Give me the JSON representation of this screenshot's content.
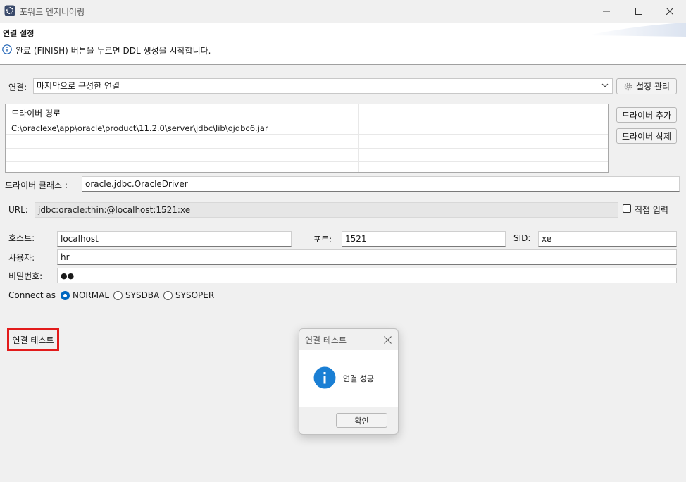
{
  "window": {
    "title": "포워드 엔지니어링",
    "minimize_icon": "minimize-icon",
    "maximize_icon": "maximize-icon",
    "close_icon": "close-icon"
  },
  "header": {
    "title": "연결 설정",
    "message": "완료 (FINISH) 버튼을 누르면 DDL 생성을 시작합니다.",
    "icon": "info-icon"
  },
  "connection": {
    "label": "연결:",
    "selected": "마지막으로 구성한 연결",
    "manage_button": "설정 관리"
  },
  "driver": {
    "path_header": "드라이버 경로",
    "paths": [
      "C:\\oraclexe\\app\\oracle\\product\\11.2.0\\server\\jdbc\\lib\\ojdbc6.jar"
    ],
    "add_button": "드라이버 추가",
    "remove_button": "드라이버 삭제",
    "class_label": "드라이버 클래스 :",
    "class_value": "oracle.jdbc.OracleDriver"
  },
  "url": {
    "label": "URL:",
    "value": "jdbc:oracle:thin:@localhost:1521:xe",
    "direct_input_label": "직접 입력",
    "direct_input_checked": false
  },
  "fields": {
    "host_label": "호스트:",
    "host_value": "localhost",
    "port_label": "포트:",
    "port_value": "1521",
    "sid_label": "SID:",
    "sid_value": "xe",
    "user_label": "사용자:",
    "user_value": "hr",
    "password_label": "비밀번호:",
    "password_value": "●●"
  },
  "connect_as": {
    "label": "Connect as",
    "options": [
      "NORMAL",
      "SYSDBA",
      "SYSOPER"
    ],
    "selected": "NORMAL"
  },
  "test": {
    "button_label": "연결 테스트",
    "highlight_color": "#e21b1b"
  },
  "dialog": {
    "title": "연결 테스트",
    "message": "연결 성공",
    "ok_button": "확인",
    "icon": "info-icon",
    "icon_color": "#1a7fd4"
  }
}
